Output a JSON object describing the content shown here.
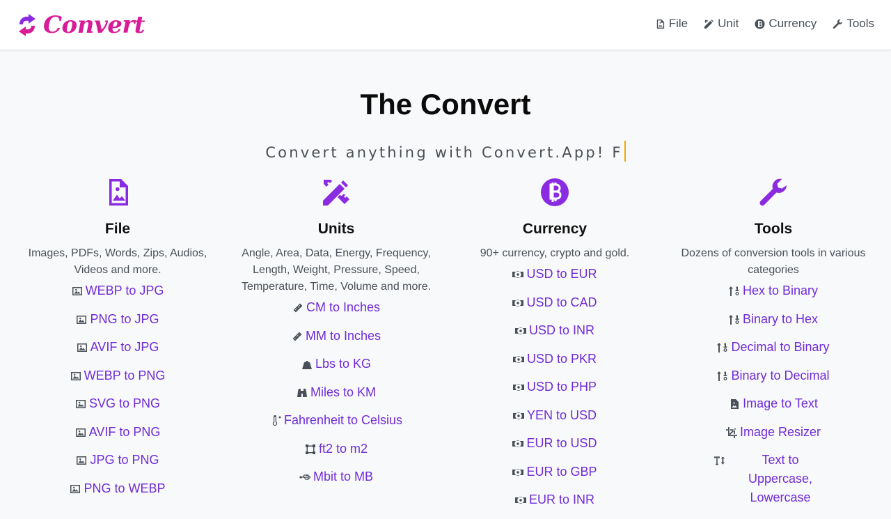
{
  "brand": {
    "name": "Convert"
  },
  "nav": [
    {
      "label": "File",
      "icon": "file-image-icon"
    },
    {
      "label": "Unit",
      "icon": "pencil-ruler-icon"
    },
    {
      "label": "Currency",
      "icon": "bitcoin-icon"
    },
    {
      "label": "Tools",
      "icon": "wrench-icon"
    }
  ],
  "hero": {
    "title": "The Convert",
    "subtitle": "Convert anything with Convert.App! F"
  },
  "colors": {
    "accent": "#8a2be2",
    "link": "#6f2bd9",
    "brand": "#d81b96",
    "caret": "#f2a900"
  },
  "columns": [
    {
      "title": "File",
      "icon": "file-image-icon",
      "description": "Images, PDFs, Words, Zips, Audios, Videos and more.",
      "links": [
        {
          "label": "WEBP to JPG",
          "icon": "image-icon"
        },
        {
          "label": "PNG to JPG",
          "icon": "image-icon"
        },
        {
          "label": "AVIF to JPG",
          "icon": "image-icon"
        },
        {
          "label": "WEBP to PNG",
          "icon": "image-icon"
        },
        {
          "label": "SVG to PNG",
          "icon": "image-icon"
        },
        {
          "label": "AVIF to PNG",
          "icon": "image-icon"
        },
        {
          "label": "JPG to PNG",
          "icon": "image-icon"
        },
        {
          "label": "PNG to WEBP",
          "icon": "image-icon"
        }
      ]
    },
    {
      "title": "Units",
      "icon": "pencil-ruler-icon",
      "description": "Angle, Area, Data, Energy, Frequency, Length, Weight, Pressure, Speed, Temperature, Time, Volume and more.",
      "links": [
        {
          "label": "CM to Inches",
          "icon": "ruler-icon"
        },
        {
          "label": "MM to Inches",
          "icon": "ruler-icon"
        },
        {
          "label": "Lbs to KG",
          "icon": "weight-icon"
        },
        {
          "label": "Miles to KM",
          "icon": "binoculars-icon"
        },
        {
          "label": "Fahrenheit to Celsius",
          "icon": "thermometer-icon"
        },
        {
          "label": "ft2 to m2",
          "icon": "vector-square-icon"
        },
        {
          "label": "Mbit to MB",
          "icon": "usb-icon"
        }
      ]
    },
    {
      "title": "Currency",
      "icon": "bitcoin-icon",
      "description": "90+ currency, crypto and gold.",
      "links": [
        {
          "label": "USD to EUR",
          "icon": "money-bill-icon"
        },
        {
          "label": "USD to CAD",
          "icon": "money-bill-icon"
        },
        {
          "label": "USD to INR",
          "icon": "money-bill-icon"
        },
        {
          "label": "USD to PKR",
          "icon": "money-bill-icon"
        },
        {
          "label": "USD to PHP",
          "icon": "money-bill-icon"
        },
        {
          "label": "YEN to USD",
          "icon": "money-bill-icon"
        },
        {
          "label": "EUR to USD",
          "icon": "money-bill-icon"
        },
        {
          "label": "EUR to GBP",
          "icon": "money-bill-icon"
        },
        {
          "label": "EUR to INR",
          "icon": "money-bill-icon"
        }
      ]
    },
    {
      "title": "Tools",
      "icon": "wrench-icon",
      "description": "Dozens of conversion tools in various categories",
      "links": [
        {
          "label": "Hex to Binary",
          "icon": "sort-numeric-icon"
        },
        {
          "label": "Binary to Hex",
          "icon": "sort-numeric-icon"
        },
        {
          "label": "Decimal to Binary",
          "icon": "sort-numeric-icon"
        },
        {
          "label": "Binary to Decimal",
          "icon": "sort-numeric-icon"
        },
        {
          "label": "Image to Text",
          "icon": "file-image-icon"
        },
        {
          "label": "Image Resizer",
          "icon": "crop-icon"
        },
        {
          "label": "Text to Uppercase, Lowercase",
          "icon": "text-height-icon"
        }
      ]
    }
  ]
}
